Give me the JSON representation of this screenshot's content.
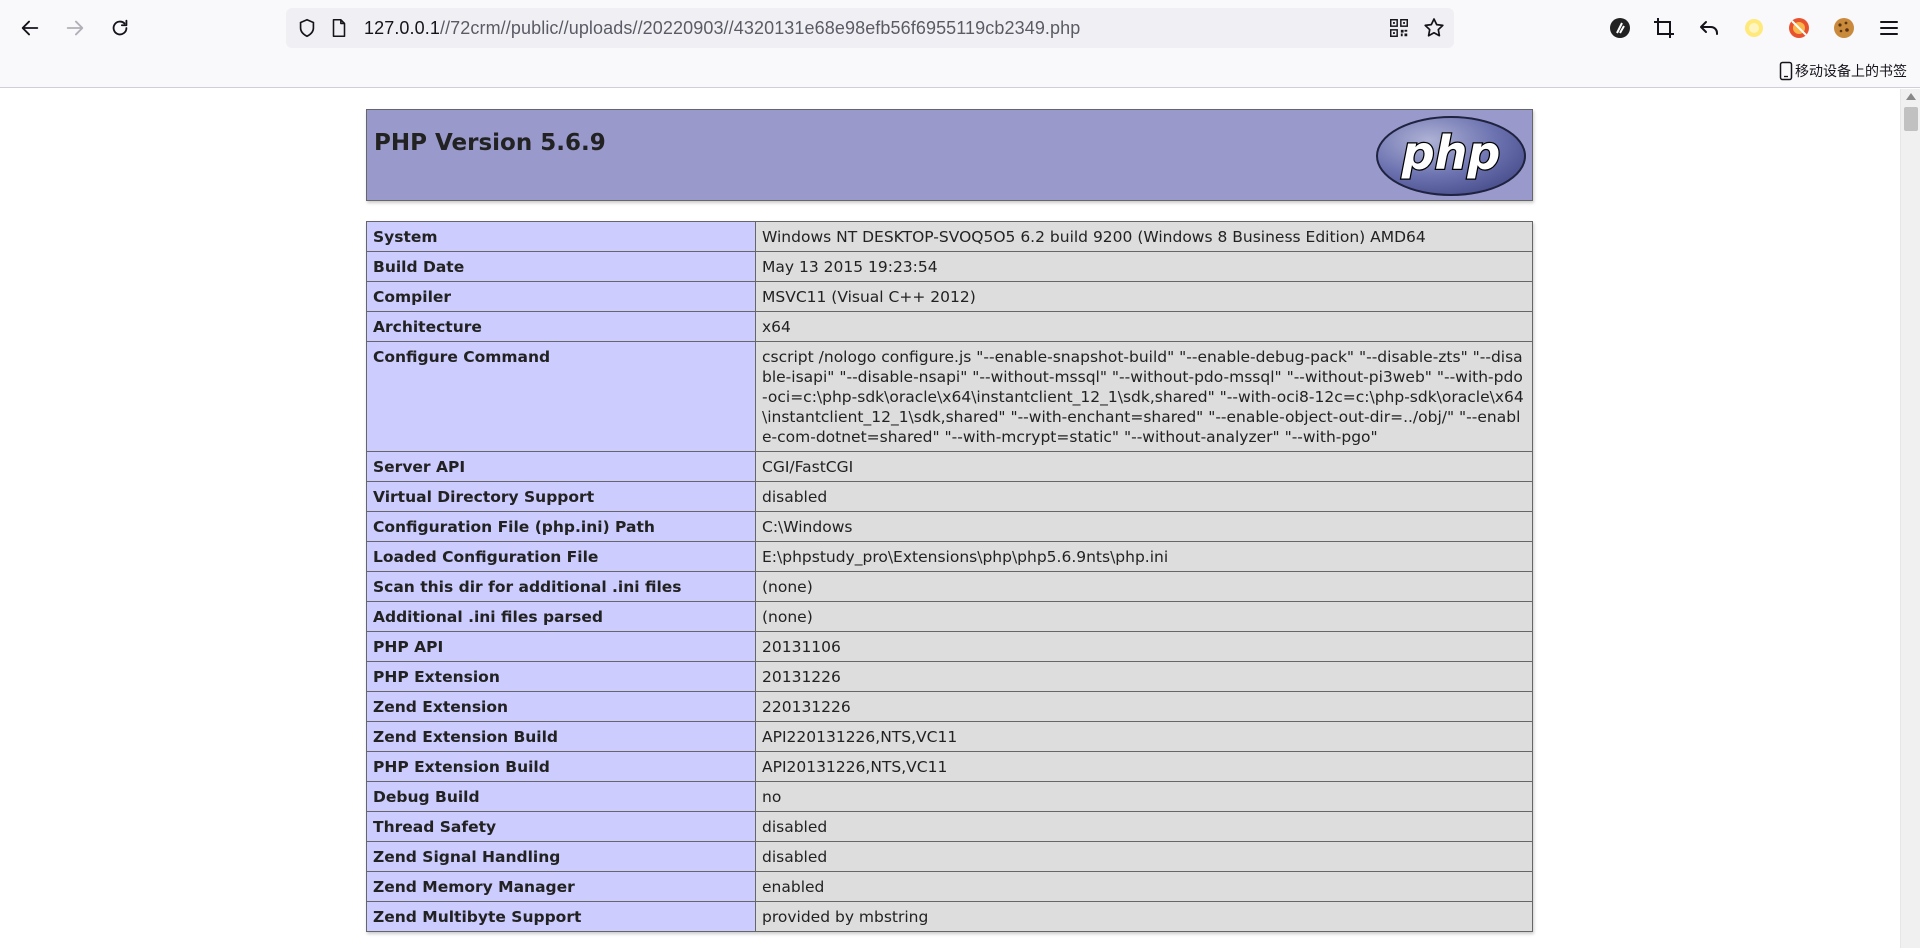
{
  "browser": {
    "url_host": "127.0.0.1",
    "url_path": "//72crm//public//uploads//20220903//4320131e68e98efb56f6955119cb2349.php",
    "bookmark_label": "移动设备上的书签",
    "icons": [
      "back-icon",
      "forward-icon",
      "reload-icon",
      "shield-icon",
      "page-icon",
      "qr-code-icon",
      "bookmark-star-icon",
      "extension-icons",
      "menu-icon"
    ]
  },
  "phpinfo": {
    "title": "PHP Version 5.6.9",
    "logo_text": "php",
    "rows": [
      {
        "key": "System",
        "value": "Windows NT DESKTOP-SVOQ5O5 6.2 build 9200 (Windows 8 Business Edition) AMD64"
      },
      {
        "key": "Build Date",
        "value": "May 13 2015 19:23:54"
      },
      {
        "key": "Compiler",
        "value": "MSVC11 (Visual C++ 2012)"
      },
      {
        "key": "Architecture",
        "value": "x64"
      },
      {
        "key": "Configure Command",
        "value": "cscript /nologo configure.js \"--enable-snapshot-build\" \"--enable-debug-pack\" \"--disable-zts\" \"--disable-isapi\" \"--disable-nsapi\" \"--without-mssql\" \"--without-pdo-mssql\" \"--without-pi3web\" \"--with-pdo-oci=c:\\php-sdk\\oracle\\x64\\instantclient_12_1\\sdk,shared\" \"--with-oci8-12c=c:\\php-sdk\\oracle\\x64\\instantclient_12_1\\sdk,shared\" \"--with-enchant=shared\" \"--enable-object-out-dir=../obj/\" \"--enable-com-dotnet=shared\" \"--with-mcrypt=static\" \"--without-analyzer\" \"--with-pgo\""
      },
      {
        "key": "Server API",
        "value": "CGI/FastCGI"
      },
      {
        "key": "Virtual Directory Support",
        "value": "disabled"
      },
      {
        "key": "Configuration File (php.ini) Path",
        "value": "C:\\Windows"
      },
      {
        "key": "Loaded Configuration File",
        "value": "E:\\phpstudy_pro\\Extensions\\php\\php5.6.9nts\\php.ini"
      },
      {
        "key": "Scan this dir for additional .ini files",
        "value": "(none)"
      },
      {
        "key": "Additional .ini files parsed",
        "value": "(none)"
      },
      {
        "key": "PHP API",
        "value": "20131106"
      },
      {
        "key": "PHP Extension",
        "value": "20131226"
      },
      {
        "key": "Zend Extension",
        "value": "220131226"
      },
      {
        "key": "Zend Extension Build",
        "value": "API220131226,NTS,VC11"
      },
      {
        "key": "PHP Extension Build",
        "value": "API20131226,NTS,VC11"
      },
      {
        "key": "Debug Build",
        "value": "no"
      },
      {
        "key": "Thread Safety",
        "value": "disabled"
      },
      {
        "key": "Zend Signal Handling",
        "value": "disabled"
      },
      {
        "key": "Zend Memory Manager",
        "value": "enabled"
      },
      {
        "key": "Zend Multibyte Support",
        "value": "provided by mbstring"
      }
    ]
  }
}
